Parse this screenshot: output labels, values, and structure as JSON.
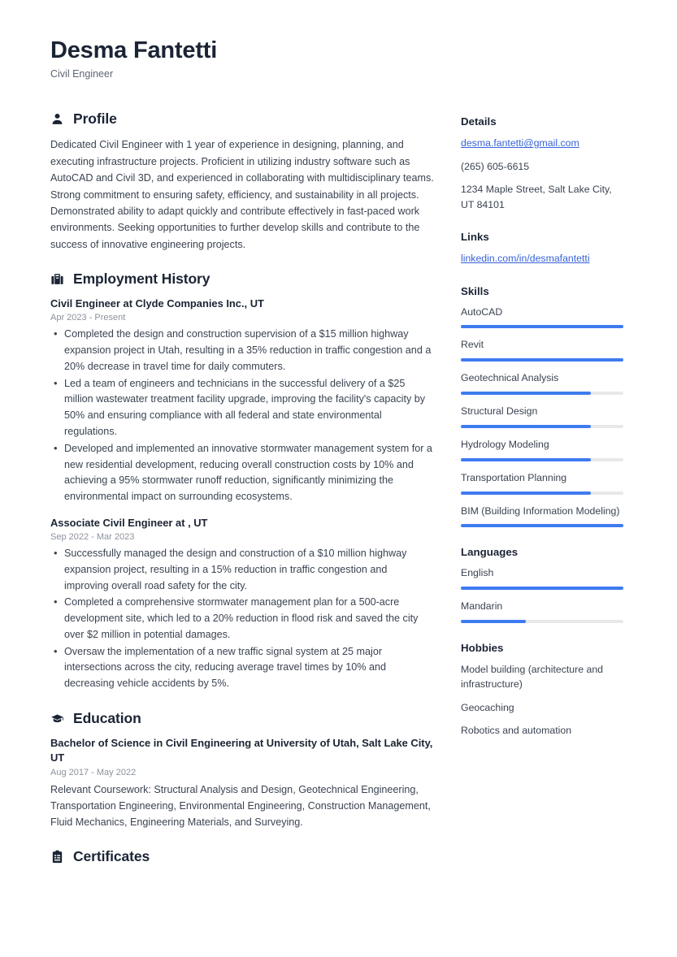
{
  "accent_color": "#3e7bf0",
  "header": {
    "name": "Desma Fantetti",
    "job_title": "Civil Engineer"
  },
  "sections": {
    "profile": {
      "title": "Profile",
      "icon": "person-icon",
      "text": "Dedicated Civil Engineer with 1 year of experience in designing, planning, and executing infrastructure projects. Proficient in utilizing industry software such as AutoCAD and Civil 3D, and experienced in collaborating with multidisciplinary teams. Strong commitment to ensuring safety, efficiency, and sustainability in all projects. Demonstrated ability to adapt quickly and contribute effectively in fast-paced work environments. Seeking opportunities to further develop skills and contribute to the success of innovative engineering projects."
    },
    "employment": {
      "title": "Employment History",
      "icon": "briefcase-icon",
      "entries": [
        {
          "title": "Civil Engineer at Clyde Companies Inc., UT",
          "date": "Apr 2023 - Present",
          "bullets": [
            "Completed the design and construction supervision of a $15 million highway expansion project in Utah, resulting in a 35% reduction in traffic congestion and a 20% decrease in travel time for daily commuters.",
            "Led a team of engineers and technicians in the successful delivery of a $25 million wastewater treatment facility upgrade, improving the facility's capacity by 50% and ensuring compliance with all federal and state environmental regulations.",
            "Developed and implemented an innovative stormwater management system for a new residential development, reducing overall construction costs by 10% and achieving a 95% stormwater runoff reduction, significantly minimizing the environmental impact on surrounding ecosystems."
          ]
        },
        {
          "title": "Associate Civil Engineer at , UT",
          "date": "Sep 2022 - Mar 2023",
          "bullets": [
            "Successfully managed the design and construction of a $10 million highway expansion project, resulting in a 15% reduction in traffic congestion and improving overall road safety for the city.",
            "Completed a comprehensive stormwater management plan for a 500-acre development site, which led to a 20% reduction in flood risk and saved the city over $2 million in potential damages.",
            "Oversaw the implementation of a new traffic signal system at 25 major intersections across the city, reducing average travel times by 10% and decreasing vehicle accidents by 5%."
          ]
        }
      ]
    },
    "education": {
      "title": "Education",
      "icon": "graduation-cap-icon",
      "entries": [
        {
          "title": "Bachelor of Science in Civil Engineering at University of Utah, Salt Lake City, UT",
          "date": "Aug 2017 - May 2022",
          "description": "Relevant Coursework: Structural Analysis and Design, Geotechnical Engineering, Transportation Engineering, Environmental Engineering, Construction Management, Fluid Mechanics, Engineering Materials, and Surveying."
        }
      ]
    },
    "certificates": {
      "title": "Certificates",
      "icon": "clipboard-icon"
    }
  },
  "sidebar": {
    "details": {
      "title": "Details",
      "email": "desma.fantetti@gmail.com",
      "phone": "(265) 605-6615",
      "address": "1234 Maple Street, Salt Lake City, UT 84101"
    },
    "links": {
      "title": "Links",
      "items": [
        {
          "label": "linkedin.com/in/desmafantetti"
        }
      ]
    },
    "skills": {
      "title": "Skills",
      "items": [
        {
          "label": "AutoCAD",
          "level": 100
        },
        {
          "label": "Revit",
          "level": 100
        },
        {
          "label": "Geotechnical Analysis",
          "level": 80
        },
        {
          "label": "Structural Design",
          "level": 80
        },
        {
          "label": "Hydrology Modeling",
          "level": 80
        },
        {
          "label": "Transportation Planning",
          "level": 80
        },
        {
          "label": "BIM (Building Information Modeling)",
          "level": 100
        }
      ]
    },
    "languages": {
      "title": "Languages",
      "items": [
        {
          "label": "English",
          "level": 100
        },
        {
          "label": "Mandarin",
          "level": 40
        }
      ]
    },
    "hobbies": {
      "title": "Hobbies",
      "items": [
        {
          "label": "Model building (architecture and infrastructure)"
        },
        {
          "label": "Geocaching"
        },
        {
          "label": "Robotics and automation"
        }
      ]
    }
  }
}
